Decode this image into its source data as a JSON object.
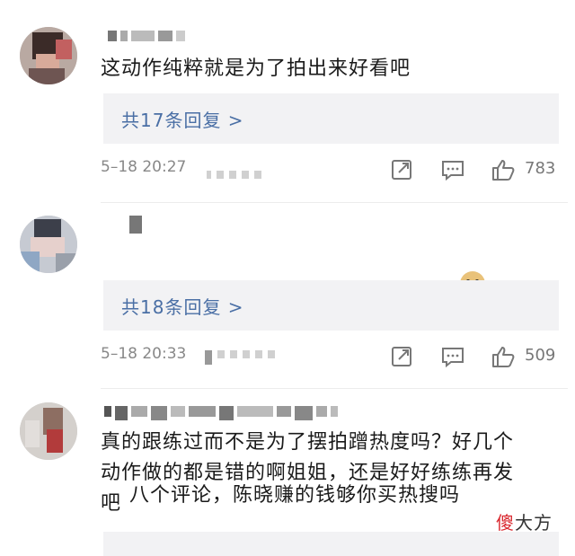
{
  "comments": [
    {
      "text": "这动作纯粹就是为了拍出来好看吧",
      "reply_label": "共17条回复 >",
      "time": "5–18 20:27",
      "likes": "783",
      "icons": [
        "share-icon",
        "comment-icon",
        "like-icon"
      ]
    },
    {
      "text": "八个评论，陈晓赚的钱够你买热搜吗",
      "emoji": "doge-emoji",
      "reply_label": "共18条回复 >",
      "time": "5–18 20:33",
      "likes": "509",
      "icons": [
        "share-icon",
        "comment-icon",
        "like-icon"
      ]
    },
    {
      "text": "真的跟练过而不是为了摆拍蹭热度吗？好几个\n动作做的都是错的啊姐姐，还是好好练练再发\n吧"
    }
  ],
  "watermark": {
    "part1": "傻",
    "part2": "大方"
  }
}
